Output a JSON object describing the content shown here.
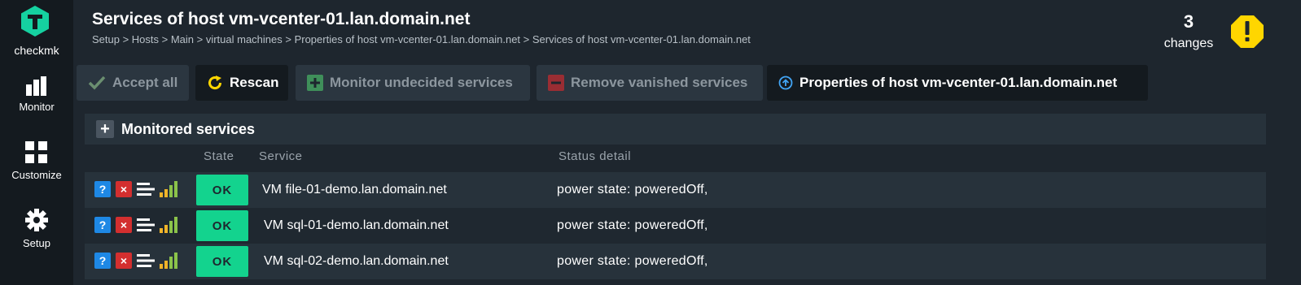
{
  "sidebar": {
    "logo_text": "checkmk",
    "items": [
      {
        "label": "Monitor",
        "icon": "monitor-bars-icon"
      },
      {
        "label": "Customize",
        "icon": "customize-grid-icon"
      },
      {
        "label": "Setup",
        "icon": "setup-gear-icon"
      }
    ]
  },
  "header": {
    "title": "Services of host vm-vcenter-01.lan.domain.net",
    "breadcrumb": "Setup > Hosts > Main > virtual machines > Properties of host vm-vcenter-01.lan.domain.net > Services of host  vm-vcenter-01.lan.domain.net",
    "changes_count": "3",
    "changes_label": "changes"
  },
  "toolbar": {
    "accept_all": "Accept all",
    "rescan": "Rescan",
    "monitor_undecided": "Monitor undecided services",
    "remove_vanished": "Remove vanished services",
    "properties": "Properties of host vm-vcenter-01.lan.domain.net"
  },
  "table": {
    "section_title": "Monitored services",
    "columns": {
      "state": "State",
      "service": "Service",
      "status_detail": "Status detail"
    },
    "rows": [
      {
        "state": "OK",
        "service": "VM file-01-demo.lan.domain.net",
        "detail": "power state: poweredOff,"
      },
      {
        "state": "OK",
        "service": "VM sql-01-demo.lan.domain.net",
        "detail": "power state: poweredOff,"
      },
      {
        "state": "OK",
        "service": "VM sql-02-demo.lan.domain.net",
        "detail": "power state: poweredOff,"
      }
    ],
    "row_icons": {
      "help": "?",
      "delete": "×"
    }
  },
  "colors": {
    "brand_green": "#15d1a0",
    "ok_green": "#13d38e",
    "warning_yellow": "#ffd600",
    "help_blue": "#1e88e5",
    "delete_red": "#d32f2f"
  }
}
